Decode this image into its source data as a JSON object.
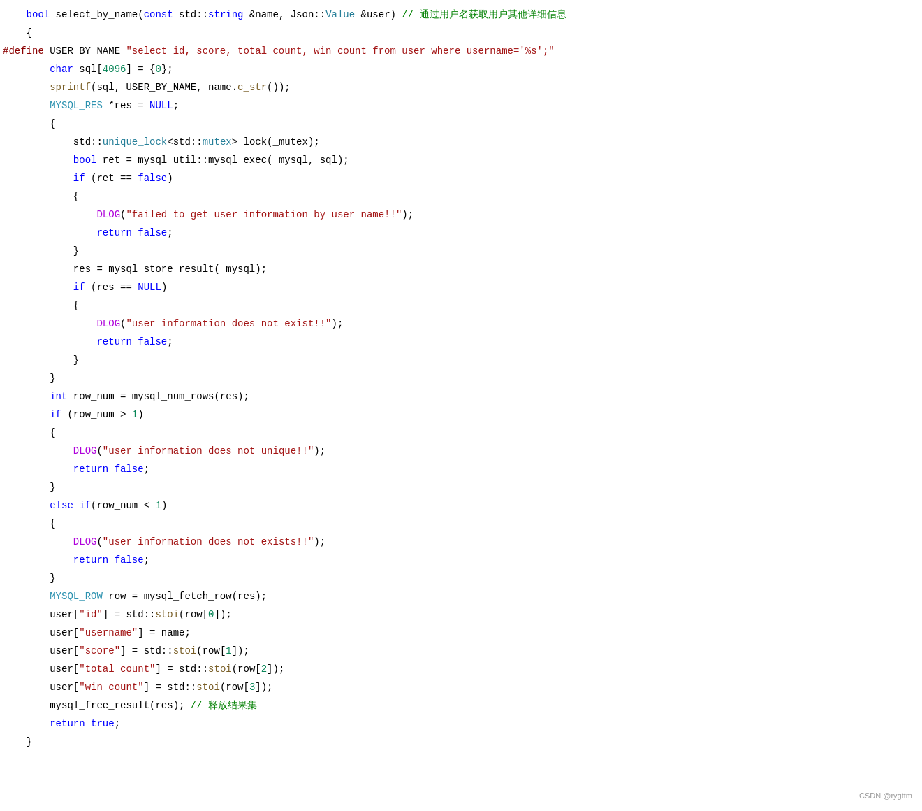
{
  "editor": {
    "background": "#ffffff",
    "watermark": "CSDN @rygttm",
    "lines": [
      {
        "id": 1,
        "indent": "    ",
        "segments": [
          {
            "text": "bool",
            "cls": "c-keyword"
          },
          {
            "text": " select_by_name(",
            "cls": "c-plain"
          },
          {
            "text": "const",
            "cls": "c-keyword"
          },
          {
            "text": " std::",
            "cls": "c-plain"
          },
          {
            "text": "string",
            "cls": "c-keyword"
          },
          {
            "text": " &name, Json::",
            "cls": "c-plain"
          },
          {
            "text": "Value",
            "cls": "c-namespace"
          },
          {
            "text": " &user) ",
            "cls": "c-plain"
          },
          {
            "text": "// 通过用户名获取用户其他详细信息",
            "cls": "c-comment"
          }
        ]
      },
      {
        "id": 2,
        "indent": "    ",
        "segments": [
          {
            "text": "{",
            "cls": "c-plain"
          }
        ]
      },
      {
        "id": 3,
        "indent": "",
        "segments": [
          {
            "text": "#define",
            "cls": "c-define"
          },
          {
            "text": " USER_BY_NAME ",
            "cls": "c-plain"
          },
          {
            "text": "\"select id, score, total_count, win_count from user where username='%s';\"",
            "cls": "c-string"
          }
        ]
      },
      {
        "id": 4,
        "indent": "        ",
        "segments": [
          {
            "text": "char",
            "cls": "c-keyword"
          },
          {
            "text": " sql[",
            "cls": "c-plain"
          },
          {
            "text": "4096",
            "cls": "c-number"
          },
          {
            "text": "] = {",
            "cls": "c-plain"
          },
          {
            "text": "0",
            "cls": "c-number"
          },
          {
            "text": "};",
            "cls": "c-plain"
          }
        ]
      },
      {
        "id": 5,
        "indent": "        ",
        "segments": [
          {
            "text": "sprintf",
            "cls": "c-func"
          },
          {
            "text": "(sql, USER_BY_NAME, name.",
            "cls": "c-plain"
          },
          {
            "text": "c_str",
            "cls": "c-func"
          },
          {
            "text": "());",
            "cls": "c-plain"
          }
        ]
      },
      {
        "id": 6,
        "indent": "        ",
        "segments": [
          {
            "text": "MYSQL_RES",
            "cls": "c-macro-type"
          },
          {
            "text": " *res = ",
            "cls": "c-plain"
          },
          {
            "text": "NULL",
            "cls": "c-keyword"
          },
          {
            "text": ";",
            "cls": "c-plain"
          }
        ]
      },
      {
        "id": 7,
        "indent": "        ",
        "segments": [
          {
            "text": "{",
            "cls": "c-plain"
          }
        ]
      },
      {
        "id": 8,
        "indent": "            ",
        "segments": [
          {
            "text": "std::",
            "cls": "c-plain"
          },
          {
            "text": "unique_lock",
            "cls": "c-namespace"
          },
          {
            "text": "<std::",
            "cls": "c-plain"
          },
          {
            "text": "mutex",
            "cls": "c-namespace"
          },
          {
            "text": "> lock(_mutex);",
            "cls": "c-plain"
          }
        ]
      },
      {
        "id": 9,
        "indent": "            ",
        "segments": [
          {
            "text": "bool",
            "cls": "c-keyword"
          },
          {
            "text": " ret = mysql_util::mysql_exec(_mysql, sql);",
            "cls": "c-plain"
          }
        ]
      },
      {
        "id": 10,
        "indent": "            ",
        "segments": [
          {
            "text": "if",
            "cls": "c-keyword"
          },
          {
            "text": " (ret == ",
            "cls": "c-plain"
          },
          {
            "text": "false",
            "cls": "c-bool-val"
          },
          {
            "text": ")",
            "cls": "c-plain"
          }
        ]
      },
      {
        "id": 11,
        "indent": "            ",
        "segments": [
          {
            "text": "{",
            "cls": "c-plain"
          }
        ]
      },
      {
        "id": 12,
        "indent": "                ",
        "segments": [
          {
            "text": "DLOG",
            "cls": "c-dlog"
          },
          {
            "text": "(",
            "cls": "c-plain"
          },
          {
            "text": "\"failed to get user information by user name!!\"",
            "cls": "c-string"
          },
          {
            "text": ");",
            "cls": "c-plain"
          }
        ]
      },
      {
        "id": 13,
        "indent": "                ",
        "segments": [
          {
            "text": "return",
            "cls": "c-keyword"
          },
          {
            "text": " ",
            "cls": "c-plain"
          },
          {
            "text": "false",
            "cls": "c-bool-val"
          },
          {
            "text": ";",
            "cls": "c-plain"
          }
        ]
      },
      {
        "id": 14,
        "indent": "            ",
        "segments": [
          {
            "text": "}",
            "cls": "c-plain"
          }
        ]
      },
      {
        "id": 15,
        "indent": "            ",
        "segments": [
          {
            "text": "res = mysql_store_result(_mysql);",
            "cls": "c-plain"
          }
        ]
      },
      {
        "id": 16,
        "indent": "            ",
        "segments": [
          {
            "text": "if",
            "cls": "c-keyword"
          },
          {
            "text": " (res == ",
            "cls": "c-plain"
          },
          {
            "text": "NULL",
            "cls": "c-keyword"
          },
          {
            "text": ")",
            "cls": "c-plain"
          }
        ]
      },
      {
        "id": 17,
        "indent": "            ",
        "segments": [
          {
            "text": "{",
            "cls": "c-plain"
          }
        ]
      },
      {
        "id": 18,
        "indent": "                ",
        "segments": [
          {
            "text": "DLOG",
            "cls": "c-dlog"
          },
          {
            "text": "(",
            "cls": "c-plain"
          },
          {
            "text": "\"user information does not exist!!\"",
            "cls": "c-string"
          },
          {
            "text": ");",
            "cls": "c-plain"
          }
        ]
      },
      {
        "id": 19,
        "indent": "                ",
        "segments": [
          {
            "text": "return",
            "cls": "c-keyword"
          },
          {
            "text": " ",
            "cls": "c-plain"
          },
          {
            "text": "false",
            "cls": "c-bool-val"
          },
          {
            "text": ";",
            "cls": "c-plain"
          }
        ]
      },
      {
        "id": 20,
        "indent": "            ",
        "segments": [
          {
            "text": "}",
            "cls": "c-plain"
          }
        ]
      },
      {
        "id": 21,
        "indent": "        ",
        "segments": [
          {
            "text": "}",
            "cls": "c-plain"
          }
        ]
      },
      {
        "id": 22,
        "indent": "        ",
        "segments": [
          {
            "text": "int",
            "cls": "c-keyword"
          },
          {
            "text": " row_num = mysql_num_rows(res);",
            "cls": "c-plain"
          }
        ]
      },
      {
        "id": 23,
        "indent": "        ",
        "segments": [
          {
            "text": "if",
            "cls": "c-keyword"
          },
          {
            "text": " (row_num > ",
            "cls": "c-plain"
          },
          {
            "text": "1",
            "cls": "c-number"
          },
          {
            "text": ")",
            "cls": "c-plain"
          }
        ]
      },
      {
        "id": 24,
        "indent": "        ",
        "segments": [
          {
            "text": "{",
            "cls": "c-plain"
          }
        ]
      },
      {
        "id": 25,
        "indent": "            ",
        "segments": [
          {
            "text": "DLOG",
            "cls": "c-dlog"
          },
          {
            "text": "(",
            "cls": "c-plain"
          },
          {
            "text": "\"user information does not unique!!\"",
            "cls": "c-string"
          },
          {
            "text": ");",
            "cls": "c-plain"
          }
        ]
      },
      {
        "id": 26,
        "indent": "            ",
        "segments": [
          {
            "text": "return",
            "cls": "c-keyword"
          },
          {
            "text": " ",
            "cls": "c-plain"
          },
          {
            "text": "false",
            "cls": "c-bool-val"
          },
          {
            "text": ";",
            "cls": "c-plain"
          }
        ]
      },
      {
        "id": 27,
        "indent": "        ",
        "segments": [
          {
            "text": "}",
            "cls": "c-plain"
          }
        ]
      },
      {
        "id": 28,
        "indent": "        ",
        "segments": [
          {
            "text": "else",
            "cls": "c-keyword"
          },
          {
            "text": " ",
            "cls": "c-plain"
          },
          {
            "text": "if",
            "cls": "c-keyword"
          },
          {
            "text": "(row_num < ",
            "cls": "c-plain"
          },
          {
            "text": "1",
            "cls": "c-number"
          },
          {
            "text": ")",
            "cls": "c-plain"
          }
        ]
      },
      {
        "id": 29,
        "indent": "        ",
        "segments": [
          {
            "text": "{",
            "cls": "c-plain"
          }
        ]
      },
      {
        "id": 30,
        "indent": "            ",
        "segments": [
          {
            "text": "DLOG",
            "cls": "c-dlog"
          },
          {
            "text": "(",
            "cls": "c-plain"
          },
          {
            "text": "\"user information does not exists!!\"",
            "cls": "c-string"
          },
          {
            "text": ");",
            "cls": "c-plain"
          }
        ]
      },
      {
        "id": 31,
        "indent": "            ",
        "segments": [
          {
            "text": "return",
            "cls": "c-keyword"
          },
          {
            "text": " ",
            "cls": "c-plain"
          },
          {
            "text": "false",
            "cls": "c-bool-val"
          },
          {
            "text": ";",
            "cls": "c-plain"
          }
        ]
      },
      {
        "id": 32,
        "indent": "        ",
        "segments": [
          {
            "text": "}",
            "cls": "c-plain"
          }
        ]
      },
      {
        "id": 33,
        "indent": "        ",
        "segments": [
          {
            "text": "MYSQL_ROW",
            "cls": "c-macro-type"
          },
          {
            "text": " row = mysql_fetch_row(res);",
            "cls": "c-plain"
          }
        ]
      },
      {
        "id": 34,
        "indent": "        ",
        "segments": [
          {
            "text": "user[",
            "cls": "c-plain"
          },
          {
            "text": "\"id\"",
            "cls": "c-string"
          },
          {
            "text": "] = std::",
            "cls": "c-plain"
          },
          {
            "text": "stoi",
            "cls": "c-func"
          },
          {
            "text": "(row[",
            "cls": "c-plain"
          },
          {
            "text": "0",
            "cls": "c-number"
          },
          {
            "text": "]);",
            "cls": "c-plain"
          }
        ]
      },
      {
        "id": 35,
        "indent": "        ",
        "segments": [
          {
            "text": "user[",
            "cls": "c-plain"
          },
          {
            "text": "\"username\"",
            "cls": "c-string"
          },
          {
            "text": "] = name;",
            "cls": "c-plain"
          }
        ]
      },
      {
        "id": 36,
        "indent": "        ",
        "segments": [
          {
            "text": "user[",
            "cls": "c-plain"
          },
          {
            "text": "\"score\"",
            "cls": "c-string"
          },
          {
            "text": "] = std::",
            "cls": "c-plain"
          },
          {
            "text": "stoi",
            "cls": "c-func"
          },
          {
            "text": "(row[",
            "cls": "c-plain"
          },
          {
            "text": "1",
            "cls": "c-number"
          },
          {
            "text": "]);",
            "cls": "c-plain"
          }
        ]
      },
      {
        "id": 37,
        "indent": "        ",
        "segments": [
          {
            "text": "user[",
            "cls": "c-plain"
          },
          {
            "text": "\"total_count\"",
            "cls": "c-string"
          },
          {
            "text": "] = std::",
            "cls": "c-plain"
          },
          {
            "text": "stoi",
            "cls": "c-func"
          },
          {
            "text": "(row[",
            "cls": "c-plain"
          },
          {
            "text": "2",
            "cls": "c-number"
          },
          {
            "text": "]);",
            "cls": "c-plain"
          }
        ]
      },
      {
        "id": 38,
        "indent": "        ",
        "segments": [
          {
            "text": "user[",
            "cls": "c-plain"
          },
          {
            "text": "\"win_count\"",
            "cls": "c-string"
          },
          {
            "text": "] = std::",
            "cls": "c-plain"
          },
          {
            "text": "stoi",
            "cls": "c-func"
          },
          {
            "text": "(row[",
            "cls": "c-plain"
          },
          {
            "text": "3",
            "cls": "c-number"
          },
          {
            "text": "]);",
            "cls": "c-plain"
          }
        ]
      },
      {
        "id": 39,
        "indent": "        ",
        "segments": [
          {
            "text": "mysql_free_result(res); ",
            "cls": "c-plain"
          },
          {
            "text": "// 释放结果集",
            "cls": "c-comment"
          }
        ]
      },
      {
        "id": 40,
        "indent": "        ",
        "segments": [
          {
            "text": "return",
            "cls": "c-keyword"
          },
          {
            "text": " ",
            "cls": "c-plain"
          },
          {
            "text": "true",
            "cls": "c-bool-val"
          },
          {
            "text": ";",
            "cls": "c-plain"
          }
        ]
      },
      {
        "id": 41,
        "indent": "    ",
        "segments": [
          {
            "text": "}",
            "cls": "c-plain"
          }
        ]
      }
    ]
  }
}
